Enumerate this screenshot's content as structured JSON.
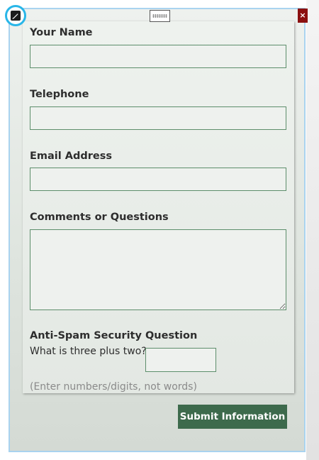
{
  "form": {
    "fields": [
      {
        "label": "Your Name",
        "value": "",
        "placeholder": ""
      },
      {
        "label": "Telephone",
        "value": "",
        "placeholder": ""
      },
      {
        "label": "Email Address",
        "value": "",
        "placeholder": ""
      },
      {
        "label": "Comments or Questions",
        "value": "",
        "placeholder": ""
      }
    ],
    "antispam": {
      "heading": "Anti-Spam Security Question",
      "question": "What is three plus two?",
      "value": "",
      "hint": "(Enter numbers/digits, not words)"
    },
    "submit_label": "Submit Information"
  },
  "widget": {
    "close_glyph": "×",
    "edit_icon": "pencil-icon",
    "drag_icon": "drag-handle-icon"
  },
  "colors": {
    "frame_border": "#a9d3ef",
    "edit_ring": "#29b6e8",
    "close_bg": "#8b1010",
    "field_border": "#5d8e6b",
    "submit_bg": "#3d6a4c"
  }
}
